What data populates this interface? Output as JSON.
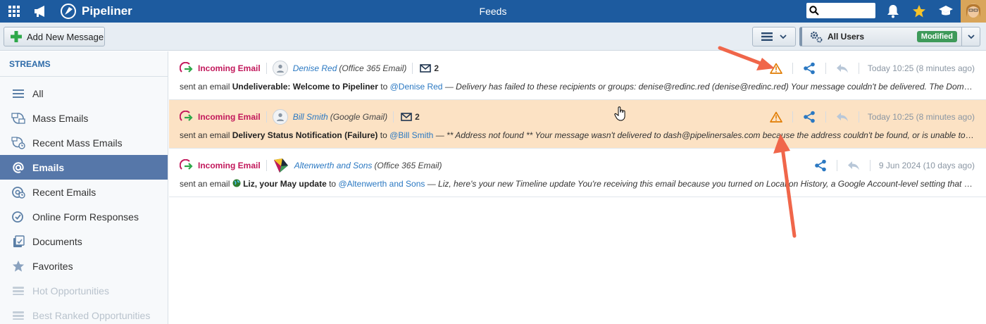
{
  "app": {
    "brand": "Pipeliner",
    "page_title": "Feeds"
  },
  "topbar": {
    "search_placeholder": ""
  },
  "toolbar": {
    "add_label": "Add New Message",
    "users_label": "All Users",
    "modified_label": "Modified"
  },
  "sidebar": {
    "heading": "STREAMS",
    "items": [
      {
        "label": "All",
        "icon": "list-icon"
      },
      {
        "label": "Mass Emails",
        "icon": "mass-email-icon"
      },
      {
        "label": "Recent Mass Emails",
        "icon": "recent-mass-email-icon"
      },
      {
        "label": "Emails",
        "icon": "at-icon",
        "active": true
      },
      {
        "label": "Recent Emails",
        "icon": "recent-email-icon"
      },
      {
        "label": "Online Form Responses",
        "icon": "form-icon"
      },
      {
        "label": "Documents",
        "icon": "documents-icon"
      },
      {
        "label": "Favorites",
        "icon": "star-icon"
      },
      {
        "label": "Hot Opportunities",
        "icon": "hot-icon",
        "dim": true
      },
      {
        "label": "Best Ranked Opportunities",
        "icon": "ranked-icon",
        "dim": true
      }
    ]
  },
  "feed": [
    {
      "type": "Incoming Email",
      "name": "Denise Red",
      "source": "(Office 365 Email)",
      "count": "2",
      "time": "Today 10:25 (8 minutes ago)",
      "prefix": "sent an email",
      "subject": "Undeliverable: Welcome to Pipeliner",
      "to": "to",
      "mention": "@Denise Red",
      "preview": "— Delivery has failed to these recipients or groups: denise@redinc.red (denise@redinc.red) Your message couldn't be delivered. The Domain Name System (DNS) reported that the recipient's domain does not exist.",
      "warning": true
    },
    {
      "type": "Incoming Email",
      "name": "Bill Smith",
      "source": "(Google Gmail)",
      "count": "2",
      "time": "Today 10:25 (8 minutes ago)",
      "prefix": "sent an email",
      "subject": "Delivery Status Notification (Failure)",
      "to": "to",
      "mention": "@Bill Smith",
      "preview": "— ** Address not found ** Your message wasn't delivered to dash@pipelinersales.com because the address couldn't be found, or is unable to receive mail.",
      "warning": true,
      "highlight": true
    },
    {
      "type": "Incoming Email",
      "name": "Altenwerth and Sons",
      "source": "(Office 365 Email)",
      "time": "9 Jun 2024 (10 days ago)",
      "prefix": "sent an email",
      "subject": "Liz, your May update",
      "to": "to",
      "mention": "@Altenwerth and Sons",
      "preview": "— Liz, here's your new Timeline update You're receiving this email because you turned on Location History, a Google Account-level setting that creates Timeline.",
      "warning": false
    }
  ],
  "colors": {
    "topbar": "#1d5b9f",
    "active": "#5677a9",
    "incoming": "#c2185b",
    "warning": "#e07b00",
    "link": "#2a78c2",
    "highlight": "#fce2c4",
    "annotation": "#f0664a"
  }
}
